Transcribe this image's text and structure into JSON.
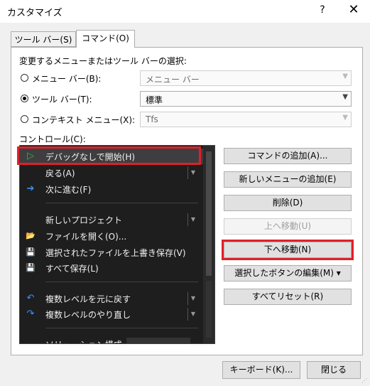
{
  "window": {
    "title": "カスタマイズ",
    "help_glyph": "?",
    "close_glyph": "✕"
  },
  "tabs": [
    {
      "label": "ツール バー(S)"
    },
    {
      "label": "コマンド(O)"
    }
  ],
  "section_label": "変更するメニューまたはツール バーの選択:",
  "options": [
    {
      "label": "メニュー バー(B):",
      "value": "メニュー バー",
      "selected": false,
      "enabled": false
    },
    {
      "label": "ツール バー(T):",
      "value": "標準",
      "selected": true,
      "enabled": true
    },
    {
      "label": "コンテキスト メニュー(X):",
      "value": "Tfs",
      "selected": false,
      "enabled": false
    }
  ],
  "controls_label": "コントロール(C):",
  "controls": [
    {
      "icon": "play-icon",
      "glyph": "▷",
      "label": "デバッグなしで開始(H)",
      "split": false
    },
    {
      "icon": "",
      "glyph": "",
      "label": "戻る(A)",
      "split": true
    },
    {
      "icon": "navigate-forward-icon",
      "glyph": "➔",
      "label": "次に進む(F)",
      "split": false
    },
    {
      "icon": "",
      "glyph": "",
      "label": "新しいプロジェクト",
      "split": true
    },
    {
      "icon": "open-file-icon",
      "glyph": "📂",
      "label": "ファイルを開く(O)...",
      "split": false
    },
    {
      "icon": "save-icon",
      "glyph": "💾",
      "label": "選択されたファイルを上書き保存(V)",
      "split": false
    },
    {
      "icon": "save-all-icon",
      "glyph": "💾",
      "label": "すべて保存(L)",
      "split": false
    },
    {
      "icon": "undo-icon",
      "glyph": "↶",
      "label": "複数レベルを元に戻す",
      "split": true
    },
    {
      "icon": "redo-icon",
      "glyph": "↷",
      "label": "複数レベルのやり直し",
      "split": true
    },
    {
      "icon": "",
      "glyph": "",
      "label": "ソリューション構成",
      "split": false
    }
  ],
  "actions": [
    {
      "label": "コマンドの追加(A)...",
      "enabled": true
    },
    {
      "label": "新しいメニューの追加(E)",
      "enabled": true
    },
    {
      "label": "削除(D)",
      "enabled": true
    },
    {
      "label": "上へ移動(U)",
      "enabled": false
    },
    {
      "label": "下へ移動(N)",
      "enabled": true
    },
    {
      "label": "選択したボタンの編集(M) ▾",
      "enabled": true
    },
    {
      "label": "すべてリセット(R)",
      "enabled": true
    }
  ],
  "footer": {
    "keyboard": "キーボード(K)...",
    "close": "閉じる"
  },
  "colors": {
    "highlight": "#e0202a",
    "list_bg": "#1e1e1e",
    "play_icon": "#3cb043",
    "forward_icon": "#3794ff"
  }
}
